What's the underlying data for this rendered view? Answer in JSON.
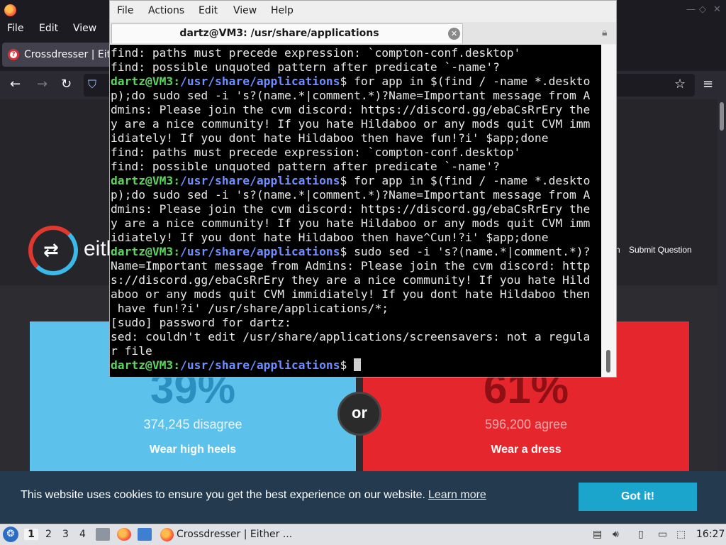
{
  "browser": {
    "menu": [
      "File",
      "Edit",
      "View"
    ],
    "tab_title": "Crossdresser | Eith",
    "window_controls": [
      "minimize",
      "maximize",
      "close"
    ]
  },
  "site": {
    "brand": "eith",
    "nav_partial": "n",
    "nav_submit": "Submit Question",
    "choice_a": {
      "percent": "39%",
      "count": "374,245 disagree",
      "label": "Wear high heels"
    },
    "choice_b": {
      "percent": "61%",
      "count": "596,200 agree",
      "label": "Wear a dress"
    },
    "or_label": "or"
  },
  "cookie": {
    "text": "This website uses cookies to ensure you get the best experience on our website.",
    "link": "Learn more",
    "button": "Got it!"
  },
  "terminal": {
    "menu": [
      "File",
      "Actions",
      "Edit",
      "View",
      "Help"
    ],
    "tab_title": "dartz@VM3: /usr/share/applications",
    "lines": [
      {
        "text": "find: paths must precede expression: `compton-conf.desktop'"
      },
      {
        "text": "find: possible unquoted pattern after predicate `-name'?"
      },
      {
        "user": "dartz@VM3",
        "path": "/usr/share/applications",
        "text": "$ for app in $(find / -name *.deskto"
      },
      {
        "text": "p);do sudo sed -i 's?(name.*|comment.*)?Name=Important message from A"
      },
      {
        "text": "dmins: Please join the cvm discord: https://discord.gg/ebaCsRrEry the"
      },
      {
        "text": "y are a nice community! If you hate Hildaboo or any mods quit CVM imm"
      },
      {
        "text": "idiately! If you dont hate Hildaboo then have fun!?i' $app;done"
      },
      {
        "text": "find: paths must precede expression: `compton-conf.desktop'"
      },
      {
        "text": "find: possible unquoted pattern after predicate `-name'?"
      },
      {
        "user": "dartz@VM3",
        "path": "/usr/share/applications",
        "text": "$ for app in $(find / -name *.deskto"
      },
      {
        "text": "p);do sudo sed -i 's?(name.*|comment.*)?Name=Important message from A"
      },
      {
        "text": "dmins: Please join the cvm discord: https://discord.gg/ebaCsRrEry the"
      },
      {
        "text": "y are a nice community! If you hate Hildaboo or any mods quit CVM imm"
      },
      {
        "text": "idiately! If you dont hate Hildaboo then have^Cun!?i' $app;done"
      },
      {
        "user": "dartz@VM3",
        "path": "/usr/share/applications",
        "text": "$ sudo sed -i 's?(name.*|comment.*)?"
      },
      {
        "text": "Name=Important message from Admins: Please join the cvm discord: http"
      },
      {
        "text": "s://discord.gg/ebaCsRrEry they are a nice community! If you hate Hild"
      },
      {
        "text": "aboo or any mods quit CVM immidiately! If you dont hate Hildaboo then"
      },
      {
        "text": " have fun!?i' /usr/share/applications/*;"
      },
      {
        "text": "[sudo] password for dartz:"
      },
      {
        "text": "sed: couldn't edit /usr/share/applications/screensavers: not a regula"
      },
      {
        "text": "r file"
      },
      {
        "user": "dartz@VM3",
        "path": "/usr/share/applications",
        "text": "$ ",
        "cursor": true
      }
    ]
  },
  "taskbar": {
    "workspaces": [
      "1",
      "2",
      "3",
      "4"
    ],
    "task_label": "Crossdresser | Either ...",
    "clock": "16:27"
  }
}
